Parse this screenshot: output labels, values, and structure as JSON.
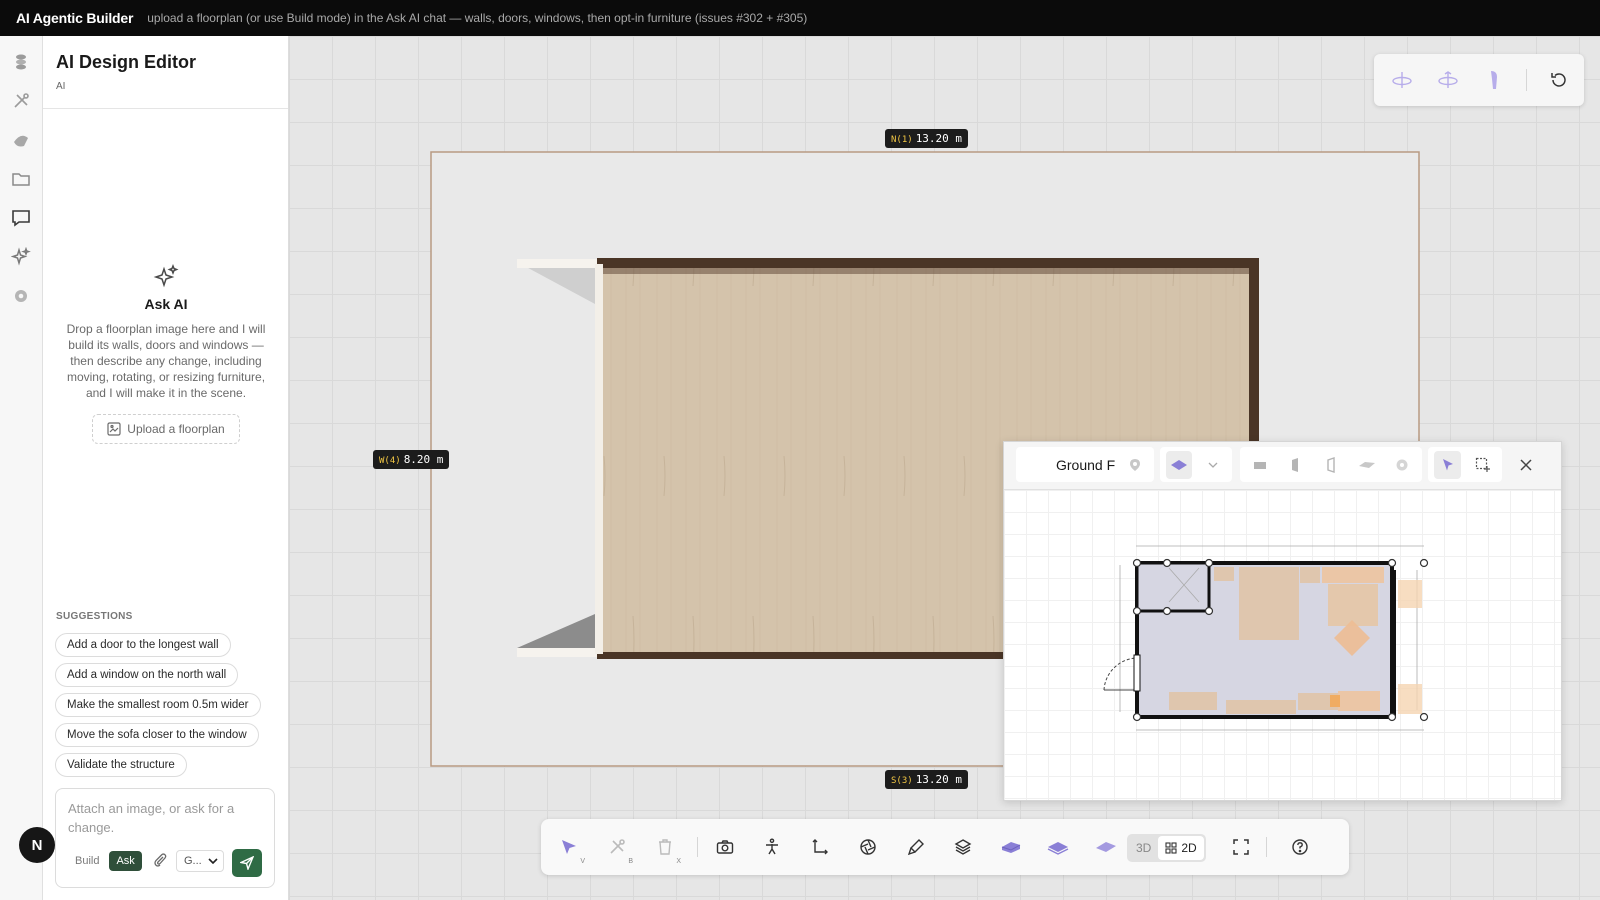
{
  "topbar": {
    "brand": "AI Agentic Builder",
    "hint": "upload a floorplan (or use Build mode) in the Ask AI chat — walls, doors, windows, then opt-in furniture (issues #302 + #305)"
  },
  "rail": {
    "icons": [
      "box-icon",
      "tools-icon",
      "shapes-icon",
      "folder-icon",
      "chat-icon",
      "sparkle-icon",
      "settings-icon"
    ],
    "active": "chat-icon",
    "avatar_initial": "N"
  },
  "sidebar": {
    "title": "AI Design Editor",
    "subtitle": "AI",
    "ask_ai": {
      "heading": "Ask AI",
      "description": "Drop a floorplan image here and I will build its walls, doors and windows — then describe any change, including moving, rotating, or resizing furniture, and I will make it in the scene.",
      "upload_label": "Upload a floorplan"
    },
    "suggestions_heading": "SUGGESTIONS",
    "suggestions": [
      "Add a door to the longest wall",
      "Add a window on the north wall",
      "Make the smallest room 0.5m wider",
      "Move the sofa closer to the window",
      "Validate the structure"
    ],
    "composer": {
      "placeholder": "Attach an image, or ask for a change.",
      "mode_build": "Build",
      "mode_ask": "Ask",
      "active_mode": "Ask",
      "model_value": "G..."
    }
  },
  "viewport": {
    "dimensions": {
      "north": {
        "key": "N(1)",
        "value": "13.20 m"
      },
      "south": {
        "key": "S(3)",
        "value": "13.20 m"
      },
      "west": {
        "key": "W(4)",
        "value": "8.20 m"
      }
    },
    "camera_controls": [
      "orbit-icon",
      "orbit-down-icon",
      "person-icon",
      "reset-icon"
    ],
    "toolbar": {
      "select_key": "V",
      "build_key": "B",
      "delete_key": "X",
      "view_3d": "3D",
      "view_2d": "2D",
      "active_view": "2D"
    }
  },
  "floorplan_panel": {
    "level_name": "Ground Floor",
    "accent": "#8a7fd6"
  },
  "colors": {
    "accent_green": "#2f6b45",
    "floor_wood": "#d4c3ab",
    "wall_dark": "#4a3526"
  }
}
